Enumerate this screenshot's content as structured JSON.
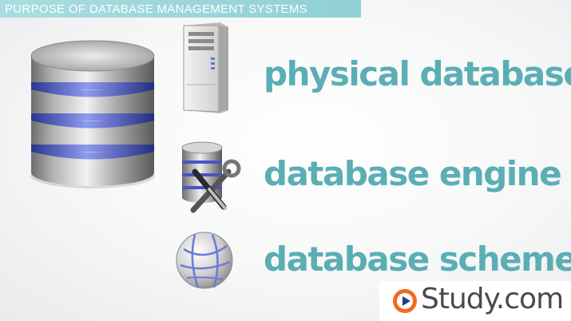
{
  "header": {
    "title": "PURPOSE OF DATABASE MANAGEMENT SYSTEMS"
  },
  "items": [
    {
      "label": "physical database",
      "icon": "server-tower-icon"
    },
    {
      "label": "database engine",
      "icon": "database-tools-icon"
    },
    {
      "label": "database scheme",
      "icon": "globe-icon"
    }
  ],
  "hero_icon": "database-stack-icon",
  "brand": {
    "name": "Study.com",
    "logo": "study-play-logo-icon"
  },
  "colors": {
    "accent_text": "#5aaeb4",
    "topbar": "#9fd8db",
    "db_band_blue": "#5f6fd0",
    "brand_orange": "#f26a21"
  }
}
